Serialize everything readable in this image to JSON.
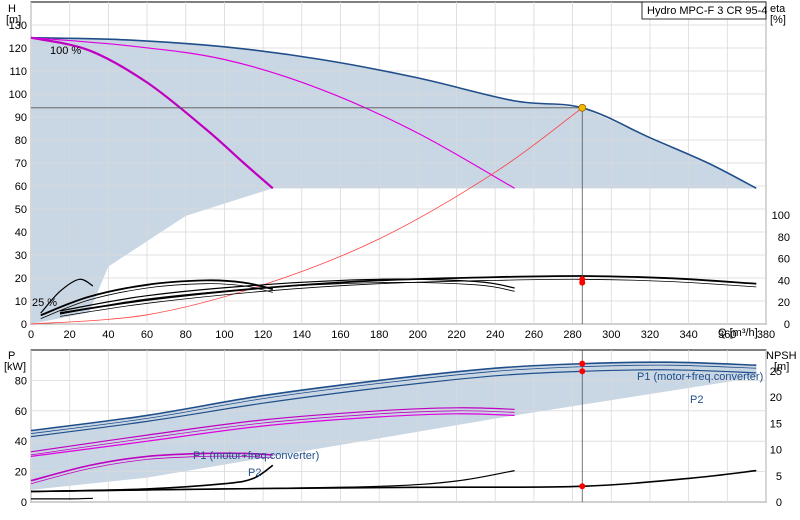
{
  "chart_data": [
    {
      "type": "line",
      "title": "Hydro MPC-F 3 CR 95-4",
      "x_axis": {
        "label": "Q [m³/h]",
        "ticks": [
          "0",
          "20",
          "40",
          "60",
          "80",
          "100",
          "120",
          "140",
          "160",
          "180",
          "200",
          "220",
          "240",
          "260",
          "280",
          "300",
          "320",
          "340",
          "360",
          "380"
        ],
        "range": [
          0,
          380
        ]
      },
      "y_left": {
        "label_line1": "H",
        "label_line2": "[m]",
        "ticks": [
          "0",
          "10",
          "20",
          "30",
          "40",
          "50",
          "60",
          "70",
          "80",
          "90",
          "100",
          "110",
          "120",
          "130"
        ],
        "range": [
          0,
          140
        ]
      },
      "y_right": {
        "label_line1": "eta",
        "label_line2": "[%]",
        "ticks": [
          "0",
          "20",
          "40",
          "60",
          "80",
          "100"
        ],
        "range": [
          0,
          100
        ]
      },
      "grid": true,
      "annotations": {
        "speed_label": "100 %",
        "min_speed_label": "25 %"
      },
      "duty_point": {
        "q": 285,
        "h": 94
      },
      "series": [
        {
          "role": "head-envelope",
          "color": "#1f4e8a",
          "x": [
            0,
            50,
            100,
            150,
            200,
            250,
            285,
            320,
            350,
            375
          ],
          "y": [
            124.5,
            123.5,
            120.5,
            115,
            107,
            97,
            94,
            81,
            70,
            59
          ]
        },
        {
          "role": "head-1pump-100",
          "color": "#c000c0",
          "x": [
            0,
            30,
            60,
            90,
            110,
            125
          ],
          "y": [
            124.5,
            119,
            105,
            85,
            70,
            59
          ]
        },
        {
          "role": "head-2pump-100",
          "color": "#e000e0",
          "x": [
            0,
            50,
            100,
            150,
            200,
            250
          ],
          "y": [
            124.5,
            121,
            115,
            102,
            83,
            59
          ]
        },
        {
          "role": "system-curve",
          "color": "#ff4040",
          "x": [
            0,
            60,
            120,
            180,
            240,
            285
          ],
          "y": [
            0,
            4,
            17,
            37,
            66,
            94
          ]
        },
        {
          "role": "eta-3pumps",
          "color": "#000000",
          "x": [
            15,
            60,
            120,
            180,
            240,
            285,
            330,
            375
          ],
          "y": [
            10,
            22,
            33,
            40,
            43,
            44,
            42,
            37
          ]
        },
        {
          "role": "eta-2pumps",
          "color": "#000000",
          "x": [
            15,
            60,
            120,
            180,
            230,
            250
          ],
          "y": [
            12,
            26,
            36,
            41,
            39,
            33
          ]
        },
        {
          "role": "eta-1pump",
          "color": "#000000",
          "x": [
            5,
            30,
            60,
            90,
            110,
            125
          ],
          "y": [
            8,
            25,
            36,
            40,
            38,
            32
          ]
        },
        {
          "role": "eta-low-speed",
          "color": "#000000",
          "x": [
            5,
            15,
            25,
            32
          ],
          "y": [
            10,
            30,
            41,
            35
          ]
        }
      ],
      "operating_points_eta": [
        {
          "q": 285,
          "eta": 41
        },
        {
          "q": 285,
          "eta": 38
        }
      ]
    },
    {
      "type": "line",
      "x_axis": {
        "ticks": [],
        "range": [
          0,
          380
        ]
      },
      "y_left": {
        "label_line1": "P",
        "label_line2": "[kW]",
        "ticks": [
          "0",
          "20",
          "40",
          "60",
          "80"
        ],
        "range": [
          0,
          100
        ]
      },
      "y_right": {
        "label_line1": "NPSH",
        "label_line2": "[m]",
        "ticks": [
          "0",
          "5",
          "10",
          "15",
          "20",
          "25"
        ],
        "range": [
          0,
          29
        ]
      },
      "grid": true,
      "series_labels": {
        "p1_3pumps": "P1 (motor+freq.converter)",
        "p2_3pumps": "P2",
        "p1_1pump": "P1 (motor+freq.converter)",
        "p2_1pump": "P2"
      },
      "series": [
        {
          "role": "p1-3pumps",
          "color": "#1f4e8a",
          "x": [
            0,
            60,
            120,
            180,
            240,
            285,
            330,
            375
          ],
          "y": [
            47,
            57,
            70,
            80,
            88,
            91,
            92,
            90
          ]
        },
        {
          "role": "p2-3pumps",
          "color": "#1f4e8a",
          "x": [
            0,
            60,
            120,
            180,
            240,
            285,
            330,
            375
          ],
          "y": [
            43,
            53,
            65,
            75,
            83,
            86,
            87,
            85
          ]
        },
        {
          "role": "p1-2pumps",
          "color": "#c000c0",
          "x": [
            0,
            60,
            120,
            180,
            220,
            250
          ],
          "y": [
            33,
            44,
            54,
            60,
            62,
            61
          ]
        },
        {
          "role": "p2-2pumps",
          "color": "#e000e0",
          "x": [
            0,
            60,
            120,
            180,
            220,
            250
          ],
          "y": [
            30,
            40,
            50,
            56,
            58,
            57
          ]
        },
        {
          "role": "p1-1pump",
          "color": "#c000c0",
          "x": [
            0,
            30,
            60,
            90,
            110,
            125
          ],
          "y": [
            14,
            24,
            30,
            32,
            32,
            31
          ]
        },
        {
          "role": "npsh-3pumps",
          "color": "#000000",
          "x": [
            0,
            100,
            200,
            285,
            340,
            375
          ],
          "y": [
            2,
            2.5,
            2.8,
            3,
            4.5,
            6
          ]
        },
        {
          "role": "npsh-2pumps",
          "color": "#000000",
          "x": [
            0,
            100,
            180,
            220,
            250
          ],
          "y": [
            2,
            2.5,
            3,
            4,
            6
          ]
        },
        {
          "role": "npsh-1pump",
          "color": "#000000",
          "x": [
            0,
            60,
            100,
            115,
            125
          ],
          "y": [
            2,
            2.5,
            3.5,
            4.5,
            7
          ]
        },
        {
          "role": "npsh-low-speed",
          "color": "#000000",
          "x": [
            0,
            20,
            32
          ],
          "y": [
            0.6,
            0.6,
            0.7
          ]
        }
      ],
      "operating_points": [
        {
          "q": 285,
          "p": 91
        },
        {
          "q": 285,
          "p": 86
        },
        {
          "q": 285,
          "npsh": 3
        }
      ]
    }
  ]
}
